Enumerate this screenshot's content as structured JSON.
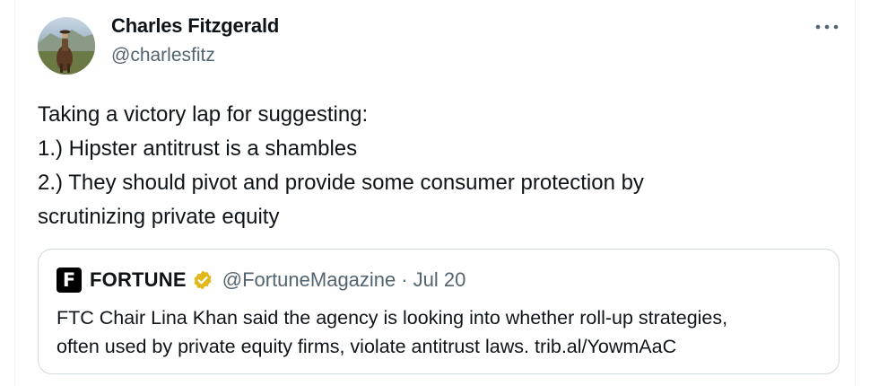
{
  "tweet": {
    "author": {
      "display_name": "Charles Fitzgerald",
      "handle": "@charlesfitz",
      "avatar_icon": "horse-rider-avatar"
    },
    "more_icon": "more-options-icon",
    "text_lines": [
      "Taking a victory lap for suggesting:",
      "1.) Hipster antitrust is a shambles",
      "2.) They should pivot and provide some consumer protection by",
      "scrutinizing private equity"
    ]
  },
  "quote": {
    "logo_letter": "F",
    "name": "FORTUNE",
    "verified_badge_color": "#e2b719",
    "handle": "@FortuneMagazine",
    "separator": "·",
    "date": "Jul 20",
    "text_lines": [
      "FTC Chair Lina Khan said the agency is looking into whether roll-up strategies,",
      "often used by private equity firms, violate antitrust laws. trib.al/YowmAaC"
    ]
  },
  "colors": {
    "text": "#0f1419",
    "secondary": "#536471",
    "border": "#cfd9de"
  }
}
